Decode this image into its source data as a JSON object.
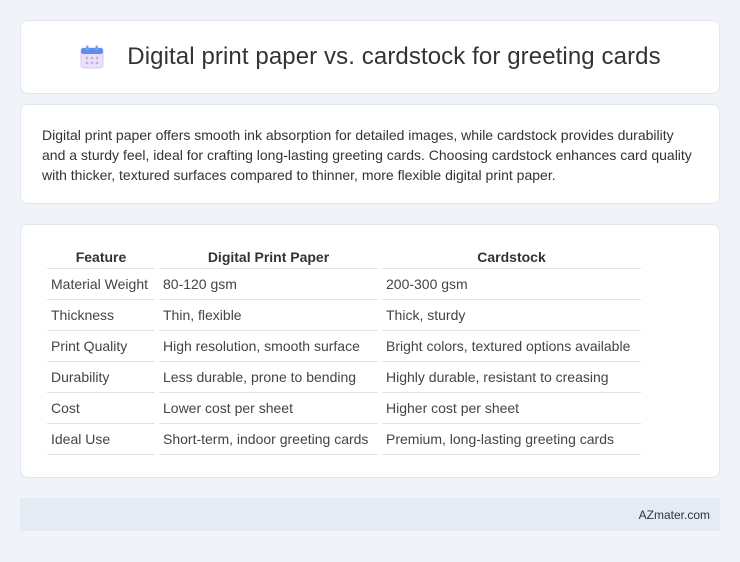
{
  "header": {
    "title": "Digital print paper vs. cardstock for greeting cards",
    "icon": "calendar-icon"
  },
  "description": "Digital print paper offers smooth ink absorption for detailed images, while cardstock provides durability and a sturdy feel, ideal for crafting long-lasting greeting cards. Choosing cardstock enhances card quality with thicker, textured surfaces compared to thinner, more flexible digital print paper.",
  "table": {
    "headers": [
      "Feature",
      "Digital Print Paper",
      "Cardstock"
    ],
    "rows": [
      [
        "Material Weight",
        "80-120 gsm",
        "200-300 gsm"
      ],
      [
        "Thickness",
        "Thin, flexible",
        "Thick, sturdy"
      ],
      [
        "Print Quality",
        "High resolution, smooth surface",
        "Bright colors, textured options available"
      ],
      [
        "Durability",
        "Less durable, prone to bending",
        "Highly durable, resistant to creasing"
      ],
      [
        "Cost",
        "Lower cost per sheet",
        "Higher cost per sheet"
      ],
      [
        "Ideal Use",
        "Short-term, indoor greeting cards",
        "Premium, long-lasting greeting cards"
      ]
    ]
  },
  "footer": {
    "site": "AZmater.com"
  },
  "colors": {
    "background": "#f0f3f8",
    "card": "#ffffff",
    "footer": "#e5ebf5",
    "icon_top": "#5b8def",
    "icon_body": "#e9dcf7"
  }
}
